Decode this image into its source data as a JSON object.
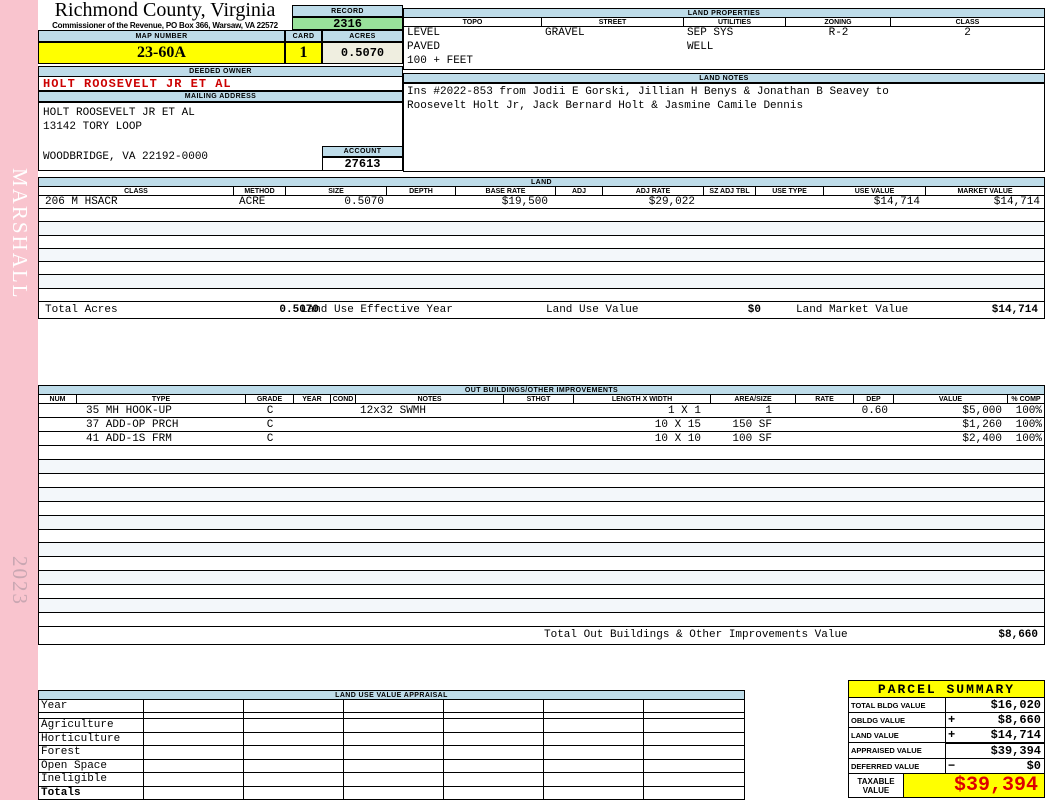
{
  "sidebar": {
    "vendor": "MARSHALL",
    "year": "2023"
  },
  "header": {
    "county": "Richmond County, Virginia",
    "subtitle": "Commissioner of the Revenue, PO Box 366, Warsaw, VA 22572",
    "record_label": "RECORD",
    "record_value": "2316",
    "map_number_label": "MAP NUMBER",
    "map_number_value": "23-60A",
    "card_label": "CARD",
    "card_value": "1",
    "acres_label": "ACRES",
    "acres_value": "0.5070"
  },
  "owner": {
    "deeded_owner_label": "DEEDED OWNER",
    "deeded_owner": "HOLT ROOSEVELT JR ET AL",
    "mailing_label": "MAILING ADDRESS",
    "mailing_lines": [
      "HOLT ROOSEVELT JR ET AL",
      "13142 TORY LOOP",
      "",
      "WOODBRIDGE, VA 22192-0000"
    ],
    "account_label": "ACCOUNT",
    "account_value": "27613"
  },
  "land_properties": {
    "title": "LAND PROPERTIES",
    "columns": [
      "TOPO",
      "STREET",
      "UTILITIES",
      "ZONING",
      "CLASS"
    ],
    "rows": [
      [
        "LEVEL",
        "GRAVEL",
        "SEP SYS",
        "R-2",
        "2"
      ],
      [
        "PAVED",
        "",
        "WELL",
        "",
        ""
      ],
      [
        "100 + FEET",
        "",
        "",
        "",
        ""
      ]
    ]
  },
  "land_notes": {
    "title": "LAND NOTES",
    "lines": [
      "Ins #2022-853 from Jodii E Gorski, Jillian H Benys & Jonathan B Seavey to",
      "Roosevelt Holt Jr, Jack Bernard Holt & Jasmine Camile Dennis"
    ]
  },
  "land": {
    "title": "LAND",
    "columns": [
      "CLASS",
      "METHOD",
      "SIZE",
      "DEPTH",
      "BASE RATE",
      "ADJ",
      "ADJ RATE",
      "SZ ADJ TBL",
      "USE TYPE",
      "USE VALUE",
      "MARKET VALUE"
    ],
    "rows": [
      [
        "206 M HSACR",
        "ACRE",
        "0.5070",
        "",
        "$19,500",
        "",
        "$29,022",
        "",
        "",
        "$14,714",
        "$14,714"
      ]
    ],
    "totals": {
      "acres_label": "Total Acres",
      "acres": "0.5070",
      "effective_year_label": "Land Use Effective Year",
      "use_value_label": "Land Use Value",
      "use_value": "$0",
      "market_value_label": "Land Market Value",
      "market_value": "$14,714"
    }
  },
  "out_buildings": {
    "title": "OUT BUILDINGS/OTHER IMPROVEMENTS",
    "columns": [
      "NUM",
      "TYPE",
      "GRADE",
      "YEAR",
      "COND",
      "NOTES",
      "STHGT",
      "LENGTH X WIDTH",
      "AREA/SIZE",
      "RATE",
      "DEP",
      "VALUE",
      "% COMP"
    ],
    "rows": [
      [
        "",
        "35 MH HOOK-UP",
        "C",
        "",
        "",
        "12x32 SWMH",
        "",
        "1 X 1",
        "1",
        "",
        "0.60",
        "$5,000",
        "100%"
      ],
      [
        "",
        "37 ADD-OP PRCH",
        "C",
        "",
        "",
        "",
        "",
        "10 X 15",
        "150 SF",
        "",
        "",
        "$1,260",
        "100%"
      ],
      [
        "",
        "41 ADD-1S FRM",
        "C",
        "",
        "",
        "",
        "",
        "10 X 10",
        "100 SF",
        "",
        "",
        "$2,400",
        "100%"
      ]
    ],
    "total_label": "Total Out Buildings & Other Improvements Value",
    "total_value": "$8,660"
  },
  "land_use_appraisal": {
    "title": "LAND USE VALUE APPRAISAL",
    "row_labels": [
      "Year",
      "Agriculture",
      "Horticulture",
      "Forest",
      "Open Space",
      "Ineligible",
      "Totals"
    ]
  },
  "parcel_summary": {
    "title": "PARCEL SUMMARY",
    "rows": [
      {
        "label": "TOTAL BLDG VALUE",
        "op": "",
        "value": "$16,020"
      },
      {
        "label": "OBLDG VALUE",
        "op": "+",
        "value": "$8,660"
      },
      {
        "label": "LAND VALUE",
        "op": "+",
        "value": "$14,714"
      },
      {
        "label": "APPRAISED VALUE",
        "op": "",
        "value": "$39,394"
      },
      {
        "label": "DEFERRED VALUE",
        "op": "−",
        "value": "$0"
      }
    ],
    "taxable_label": "TAXABLE VALUE",
    "taxable_value": "$39,394"
  },
  "colors": {
    "header_bar_blue": "#bedce9",
    "record_green": "#99e29b",
    "highlight_yellow": "#ffff00",
    "acres_cream": "#efeee0",
    "owner_red": "#cc0000",
    "taxable_red": "#dd0000",
    "sidebar_pink": "#f9c4ce",
    "empty_row_tint": "#f3f7fa"
  }
}
